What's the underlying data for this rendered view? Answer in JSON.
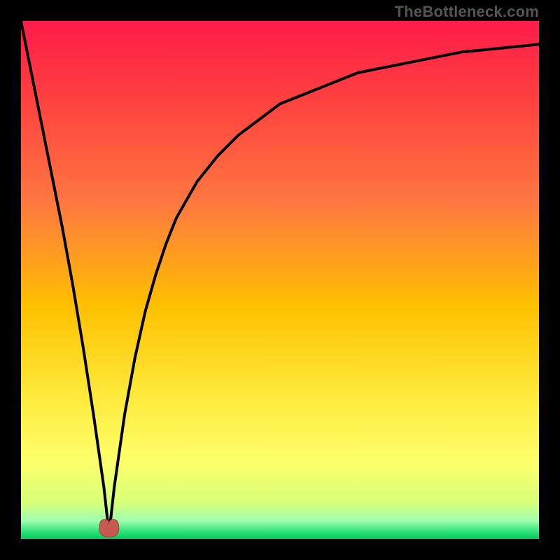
{
  "attribution": "TheBottleneck.com",
  "chart_data": {
    "type": "line",
    "title": "",
    "xlabel": "",
    "ylabel": "",
    "x_range": [
      0,
      100
    ],
    "y_range": [
      0,
      100
    ],
    "notch_x": 17,
    "notch_y_min": 1,
    "series": [
      {
        "name": "bottleneck-curve",
        "x": [
          0,
          2,
          4,
          6,
          8,
          10,
          12,
          14,
          15,
          16,
          17,
          18,
          19,
          20,
          22,
          24,
          26,
          28,
          30,
          34,
          38,
          42,
          46,
          50,
          55,
          60,
          65,
          70,
          75,
          80,
          85,
          90,
          95,
          100
        ],
        "y": [
          100,
          90,
          80,
          70,
          60,
          49,
          37,
          24,
          17,
          10,
          1,
          10,
          17,
          24,
          35,
          44,
          51,
          57,
          62,
          69,
          74,
          78,
          81,
          84,
          86,
          88,
          90,
          91,
          92,
          93,
          94,
          94.5,
          95,
          95.5
        ]
      }
    ],
    "gradient_stops": [
      {
        "offset": 0.0,
        "color": "#ff1b49"
      },
      {
        "offset": 0.15,
        "color": "#ff4040"
      },
      {
        "offset": 0.35,
        "color": "#ff7740"
      },
      {
        "offset": 0.55,
        "color": "#ffc000"
      },
      {
        "offset": 0.72,
        "color": "#ffe93a"
      },
      {
        "offset": 0.85,
        "color": "#fdff6a"
      },
      {
        "offset": 0.93,
        "color": "#d7ff77"
      },
      {
        "offset": 0.965,
        "color": "#9dffb0"
      },
      {
        "offset": 0.985,
        "color": "#33e27a"
      },
      {
        "offset": 1.0,
        "color": "#00c95b"
      }
    ],
    "marker": {
      "x": 17,
      "y": 1,
      "color": "#c45a50"
    }
  }
}
